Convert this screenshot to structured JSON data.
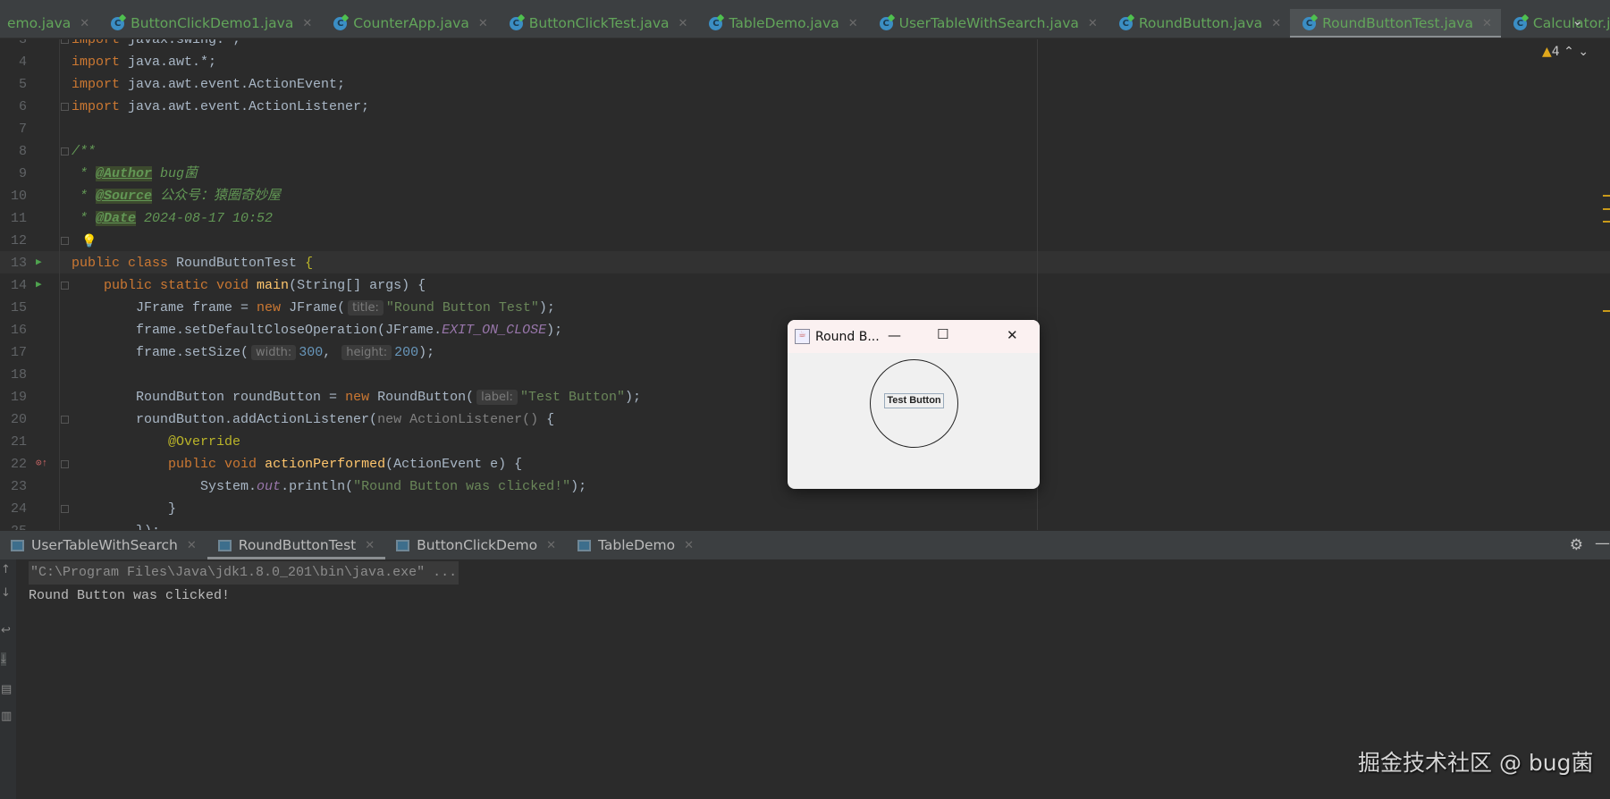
{
  "file_tabs": [
    {
      "label": "emo.java",
      "icon": false
    },
    {
      "label": "ButtonClickDemo1.java",
      "icon": true
    },
    {
      "label": "CounterApp.java",
      "icon": true
    },
    {
      "label": "ButtonClickTest.java",
      "icon": true
    },
    {
      "label": "TableDemo.java",
      "icon": true
    },
    {
      "label": "UserTableWithSearch.java",
      "icon": true
    },
    {
      "label": "RoundButton.java",
      "icon": true
    },
    {
      "label": "RoundButtonTest.java",
      "icon": true,
      "active": true
    },
    {
      "label": "Calculator.java",
      "icon": true
    }
  ],
  "editor": {
    "warning_count": "4",
    "lines": [
      {
        "n": "3",
        "t": [
          [
            "kw",
            "import "
          ],
          [
            "",
            "javax.swing.*;"
          ]
        ]
      },
      {
        "n": "4",
        "t": [
          [
            "kw",
            "import "
          ],
          [
            "",
            "java.awt.*;"
          ]
        ]
      },
      {
        "n": "5",
        "t": [
          [
            "kw",
            "import "
          ],
          [
            "",
            "java.awt.event.ActionEvent;"
          ]
        ]
      },
      {
        "n": "6",
        "t": [
          [
            "kw",
            "import "
          ],
          [
            "",
            "java.awt.event.ActionListener;"
          ]
        ]
      },
      {
        "n": "7",
        "t": []
      },
      {
        "n": "8",
        "t": [
          [
            "doc",
            "/**"
          ]
        ]
      },
      {
        "n": "9",
        "t": [
          [
            "doc",
            " * "
          ],
          [
            "tag",
            "@Author"
          ],
          [
            "doc",
            " bug菌"
          ]
        ]
      },
      {
        "n": "10",
        "t": [
          [
            "doc",
            " * "
          ],
          [
            "tag",
            "@Source"
          ],
          [
            "doc",
            " 公众号：猿圈奇妙屋"
          ]
        ]
      },
      {
        "n": "11",
        "t": [
          [
            "doc",
            " * "
          ],
          [
            "tag",
            "@Date"
          ],
          [
            "doc",
            " 2024-08-17 10:52"
          ]
        ]
      },
      {
        "n": "12",
        "t": []
      },
      {
        "n": "13",
        "t": [
          [
            "kw",
            "public class "
          ],
          [
            "",
            "RoundButtonTest "
          ],
          [
            "ann",
            "{"
          ]
        ]
      },
      {
        "n": "14",
        "t": [
          [
            "",
            "    "
          ],
          [
            "kw",
            "public static void "
          ],
          [
            "mth",
            "main"
          ],
          [
            "",
            "(String[] args) {"
          ]
        ]
      },
      {
        "n": "15",
        "t": [
          [
            "",
            "        JFrame frame = "
          ],
          [
            "kw",
            "new "
          ],
          [
            "",
            "JFrame("
          ],
          [
            "hint",
            "title:"
          ],
          [
            "str",
            "\"Round Button Test\""
          ],
          [
            "",
            ");"
          ]
        ]
      },
      {
        "n": "16",
        "t": [
          [
            "",
            "        frame.setDefaultCloseOperation(JFrame."
          ],
          [
            "fld",
            "EXIT_ON_CLOSE"
          ],
          [
            "",
            ");"
          ]
        ]
      },
      {
        "n": "17",
        "t": [
          [
            "",
            "        frame.setSize("
          ],
          [
            "hint",
            "width:"
          ],
          [
            "num",
            "300"
          ],
          [
            "",
            ", "
          ],
          [
            "hint",
            "height:"
          ],
          [
            "num",
            "200"
          ],
          [
            "",
            ");"
          ]
        ]
      },
      {
        "n": "18",
        "t": []
      },
      {
        "n": "19",
        "t": [
          [
            "",
            "        RoundButton roundButton = "
          ],
          [
            "kw",
            "new "
          ],
          [
            "",
            "RoundButton("
          ],
          [
            "hint",
            "label:"
          ],
          [
            "str",
            "\"Test Button\""
          ],
          [
            "",
            ");"
          ]
        ]
      },
      {
        "n": "20",
        "t": [
          [
            "",
            "        roundButton.addActionListener("
          ],
          [
            "gray",
            "new ActionListener() "
          ],
          [
            "",
            "{"
          ]
        ]
      },
      {
        "n": "21",
        "t": [
          [
            "",
            "            "
          ],
          [
            "ann",
            "@Override"
          ]
        ]
      },
      {
        "n": "22",
        "t": [
          [
            "",
            "            "
          ],
          [
            "kw",
            "public void "
          ],
          [
            "mth",
            "actionPerformed"
          ],
          [
            "",
            "(ActionEvent e) {"
          ]
        ]
      },
      {
        "n": "23",
        "t": [
          [
            "",
            "                System."
          ],
          [
            "fld",
            "out"
          ],
          [
            "",
            ".println("
          ],
          [
            "str",
            "\"Round Button was clicked!\""
          ],
          [
            "",
            ");"
          ]
        ]
      },
      {
        "n": "24",
        "t": [
          [
            "",
            "            }"
          ]
        ]
      },
      {
        "n": "25",
        "t": [
          [
            "",
            "        });"
          ]
        ]
      }
    ]
  },
  "run_tabs": [
    {
      "label": "UserTableWithSearch"
    },
    {
      "label": "RoundButtonTest",
      "active": true
    },
    {
      "label": "ButtonClickDemo"
    },
    {
      "label": "TableDemo"
    }
  ],
  "console": {
    "command": "\"C:\\Program Files\\Java\\jdk1.8.0_201\\bin\\java.exe\" ...",
    "output": "Round Button was clicked!"
  },
  "popup": {
    "title": "Round B...",
    "button_label": "Test Button"
  },
  "watermark": "掘金技术社区 @ bug菌",
  "colors": {
    "editor_bg": "#2b2b2b",
    "keyword": "#cc7832",
    "string": "#6a8759",
    "tab_text": "#62a55a"
  }
}
